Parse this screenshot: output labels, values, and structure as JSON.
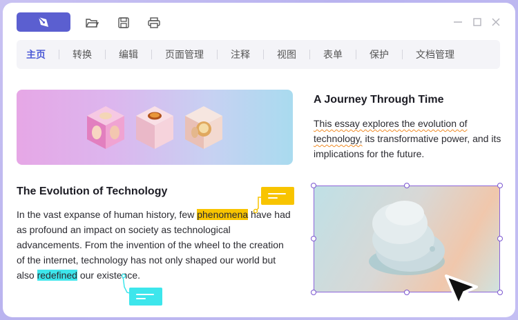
{
  "toolbar": {
    "icons": [
      "pen-logo-icon",
      "folder-open-icon",
      "save-icon",
      "print-icon"
    ]
  },
  "window_controls": [
    "minimize-icon",
    "maximize-icon",
    "close-icon"
  ],
  "menu": {
    "items": [
      {
        "label": "主页",
        "active": true
      },
      {
        "label": "转换"
      },
      {
        "label": "编辑"
      },
      {
        "label": "页面管理"
      },
      {
        "label": "注释"
      },
      {
        "label": "视图"
      },
      {
        "label": "表单"
      },
      {
        "label": "保护"
      },
      {
        "label": "文档管理"
      }
    ]
  },
  "left": {
    "title": "The Evolution of Technology",
    "p1": "In the vast expanse of human history, few ",
    "hl1": "phenomena",
    "p2": " have had as profound an impact on society as technological advancements. From the invention of the wheel to the creation of the internet, technology has not only shaped our world but also ",
    "hl2": "redefined",
    "p3": " our existence."
  },
  "right": {
    "title": "A Journey Through Time",
    "s1": "This essay explores the evolution of",
    "s2": "technology,",
    "s3": " its transformative power, and its implications for the future."
  },
  "colors": {
    "accent": "#5b5fd0",
    "highlight_yellow": "#f8c400",
    "highlight_cyan": "#3de6ec",
    "selection": "#8a63d8"
  }
}
